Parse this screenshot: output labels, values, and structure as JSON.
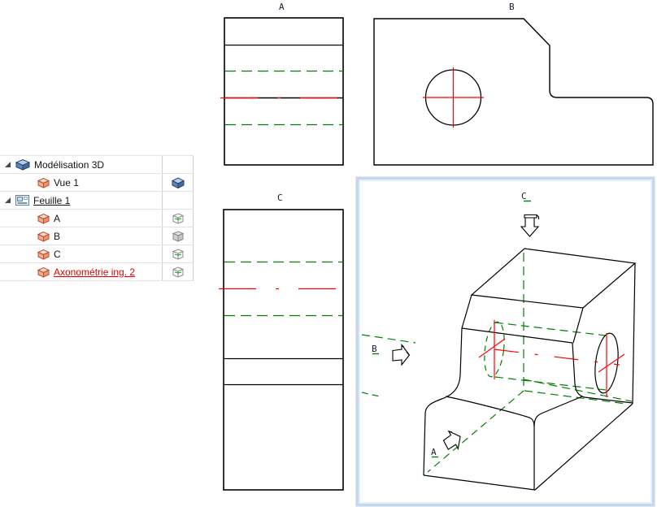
{
  "palette": {
    "outline": "#000000",
    "hidden": "#008000",
    "centerline": "#ff0000",
    "label_color": "#1a1a33",
    "selection_frame": "#c5d7eb",
    "tree_selected_text": "#e00000"
  },
  "tree": {
    "rows": [
      {
        "label": "Modélisation 3D",
        "level": "root",
        "icon": "cube-3d-blue"
      },
      {
        "label": "Vue 1",
        "level": "child",
        "icon": "cube-orange",
        "right_icon": "cube-solid-blue"
      },
      {
        "label": "Feuille 1",
        "level": "root",
        "icon": "sheet",
        "underlined": true
      },
      {
        "label": "A",
        "level": "child",
        "icon": "cube-orange",
        "right_icon": "cube-wire-green"
      },
      {
        "label": "B",
        "level": "child",
        "icon": "cube-orange",
        "right_icon": "cube-wire-gray"
      },
      {
        "label": "C",
        "level": "child",
        "icon": "cube-orange",
        "right_icon": "cube-wire-green"
      },
      {
        "label": "Axonométrie ing. 2",
        "level": "child",
        "icon": "cube-orange",
        "right_icon": "cube-wire-green",
        "selected": true
      }
    ]
  },
  "views": {
    "a": {
      "label": "A"
    },
    "b": {
      "label": "B"
    },
    "c": {
      "label": "C"
    },
    "axon": {
      "selected": true,
      "direction_labels": {
        "c": "C",
        "b": "B",
        "a": "A"
      }
    }
  }
}
